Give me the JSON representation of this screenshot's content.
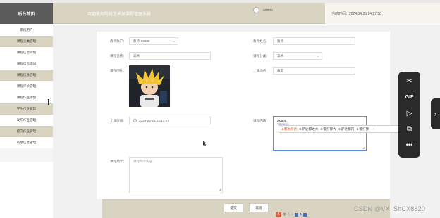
{
  "header": {
    "logo": "后台首页",
    "welcome": "欢迎使用院校艺术类课程管理系统",
    "user": "admin",
    "datetime": "当前时间：2024.04.25 14:17:58"
  },
  "sidebar": {
    "items": [
      {
        "label": "系统用户"
      },
      {
        "label": "课程分类管理"
      },
      {
        "label": "课程信息详情"
      },
      {
        "label": "课程信息添加"
      },
      {
        "label": "课程信息管理"
      },
      {
        "label": "课程评价管理"
      },
      {
        "label": "课程作业添加"
      },
      {
        "label": "学生作业管理"
      },
      {
        "label": "发布作业管理"
      },
      {
        "label": "提交作业管理"
      },
      {
        "label": "成绩信息管理"
      }
    ]
  },
  "form": {
    "teacher_account_label": "教师账户：",
    "teacher_account_value": "教师-03330",
    "teacher_name_label": "教师姓名：",
    "teacher_name_value": "教师",
    "course_name_label": "课程名称：",
    "course_name_value": "美术",
    "course_category_label": "课程分类：",
    "course_category_value": "美术",
    "course_image_label": "课程图片：",
    "class_location_label": "上课地点：",
    "class_location_value": "教室",
    "class_time_label": "上课时间：",
    "class_time_value": "2024-04-25 14:17:57",
    "course_content_label": "课程内容：",
    "course_content_value": "zxlaoti",
    "course_content_pinyin": "'xif'aorni",
    "course_intro_label": "课程简介：",
    "course_intro_placeholder": "课程简介内容"
  },
  "ime": {
    "candidates": [
      "1.都太阿达",
      "2.萨达都太大",
      "3.都打算大",
      "4.萨达都内",
      "5.都打算"
    ],
    "more": "‹ ›"
  },
  "buttons": {
    "submit": "提交",
    "cancel": "取消"
  },
  "ime_toolbar": {
    "s": "S",
    "zh": "中",
    "punct": "°,"
  },
  "watermark": "CSDN @VX_ShCX8820",
  "float_toolbar": {
    "scissors": "✂",
    "gif": "GIF",
    "play": "▷",
    "image": "⧉",
    "more": "•••",
    "handle": "›"
  }
}
